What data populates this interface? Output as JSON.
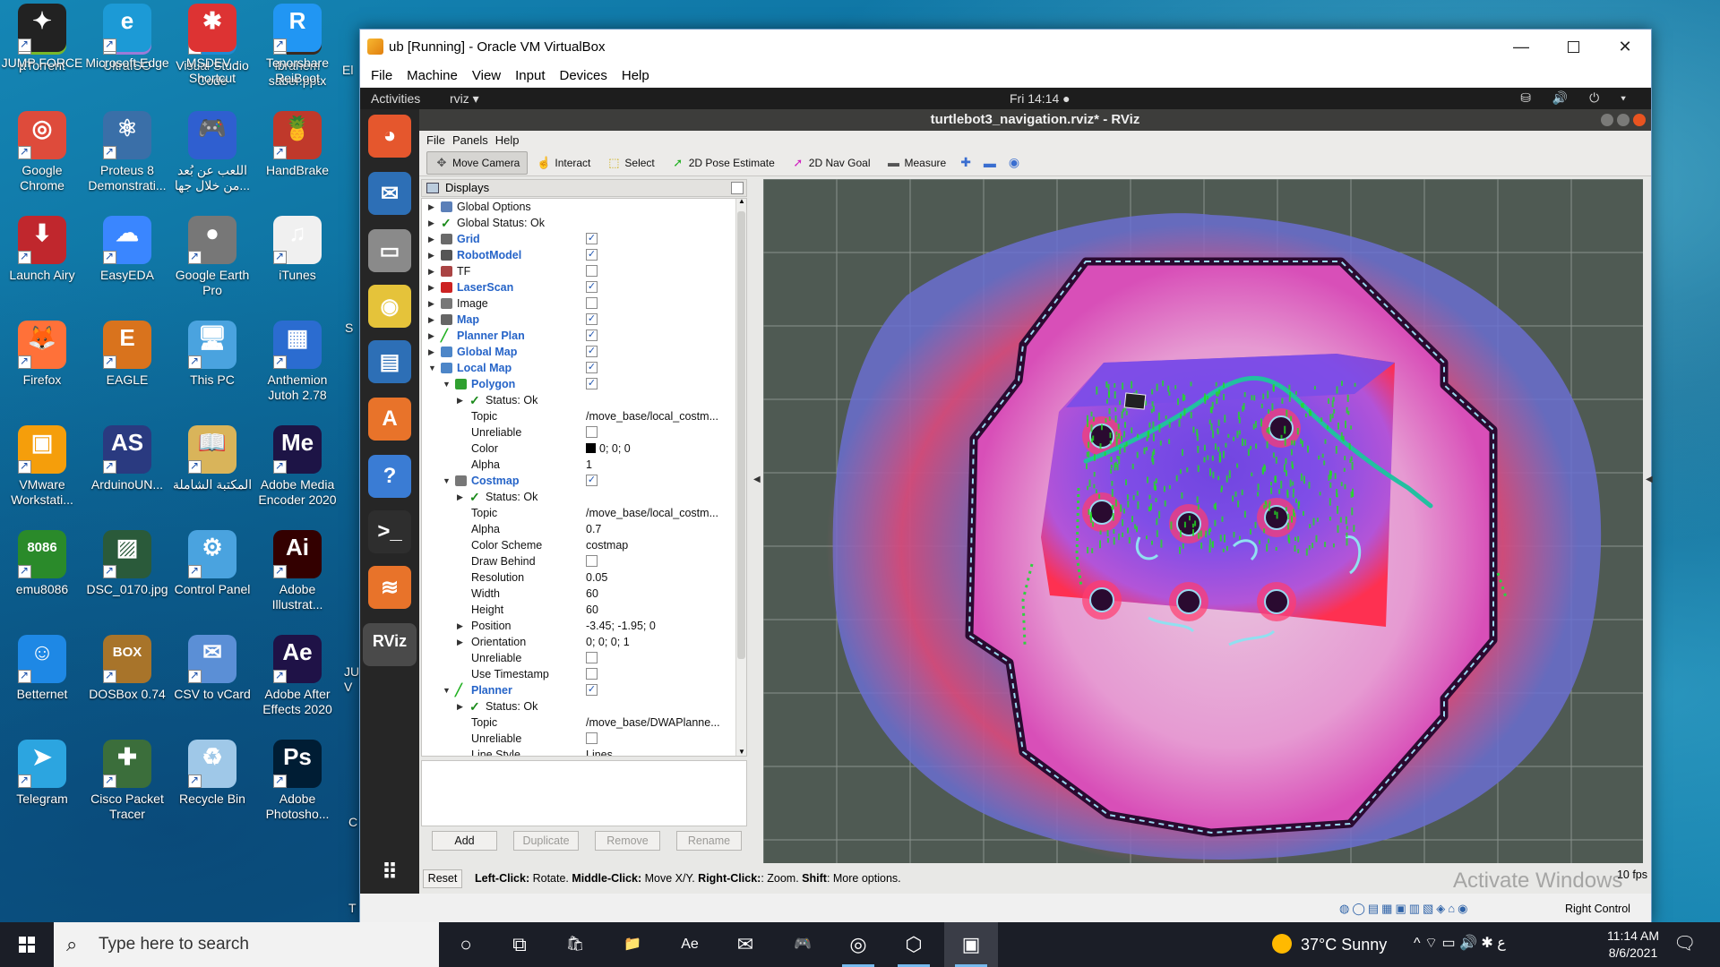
{
  "desktop": {
    "icons": [
      {
        "label": "µTorrent",
        "icon": "utorrent-icon",
        "color": "#78b82a",
        "glyph": "µ"
      },
      {
        "label": "UltraISO",
        "icon": "ultraiso-icon",
        "color": "#9c7bd8",
        "glyph": "◉"
      },
      {
        "label": "Visual Studio Code",
        "icon": "vscode-icon",
        "color": "#1f8ad2",
        "glyph": "❮❯"
      },
      {
        "label": "ibrahem saber.pptx",
        "icon": "pptx-icon",
        "color": "#3a2a20",
        "glyph": "▣"
      },
      {
        "label": "Google Chrome",
        "icon": "chrome-icon",
        "color": "#de4b3b",
        "glyph": "◎"
      },
      {
        "label": "Proteus 8 Demonstrati...",
        "icon": "proteus-icon",
        "color": "#3a6fa8",
        "glyph": "⚛"
      },
      {
        "label": "اللعب عن بُعد من خلال جها...",
        "icon": "remote-play-icon",
        "color": "#2f5fd0",
        "glyph": "🎮"
      },
      {
        "label": "HandBrake",
        "icon": "handbrake-icon",
        "color": "#c0392b",
        "glyph": "🍍"
      },
      {
        "label": "Launch Airy",
        "icon": "airy-icon",
        "color": "#c0272d",
        "glyph": "⬇"
      },
      {
        "label": "EasyEDA",
        "icon": "easyeda-icon",
        "color": "#3a86ff",
        "glyph": "☁"
      },
      {
        "label": "Google Earth Pro",
        "icon": "google-earth-icon",
        "color": "#777",
        "glyph": "●"
      },
      {
        "label": "iTunes",
        "icon": "itunes-icon",
        "color": "#f0f0f0",
        "glyph": "♫"
      },
      {
        "label": "Firefox",
        "icon": "firefox-icon",
        "color": "#ff7139",
        "glyph": "🦊"
      },
      {
        "label": "EAGLE",
        "icon": "eagle-icon",
        "color": "#d9731d",
        "glyph": "E"
      },
      {
        "label": "This PC",
        "icon": "this-pc-icon",
        "color": "#4aa3df",
        "glyph": "🖥"
      },
      {
        "label": "Anthemion Jutoh 2.78",
        "icon": "jutoh-icon",
        "color": "#2b6cd0",
        "glyph": "▦"
      },
      {
        "label": "VMware Workstati...",
        "icon": "vmware-icon",
        "color": "#f59e0b",
        "glyph": "▣"
      },
      {
        "label": "ArduinoUN...",
        "icon": "arduino-icon",
        "color": "#2a3a80",
        "glyph": "AS"
      },
      {
        "label": "المكتبة الشاملة",
        "icon": "library-icon",
        "color": "#d9b45a",
        "glyph": "📖"
      },
      {
        "label": "Adobe Media Encoder 2020",
        "icon": "media-encoder-icon",
        "color": "#1d1446",
        "glyph": "Me"
      },
      {
        "label": "emu8086",
        "icon": "emu8086-icon",
        "color": "#2a8a2a",
        "glyph": "8086"
      },
      {
        "label": "DSC_0170.jpg",
        "icon": "photo-icon",
        "color": "#2a5a3a",
        "glyph": "▨"
      },
      {
        "label": "Control Panel",
        "icon": "control-panel-icon",
        "color": "#4aa3df",
        "glyph": "⚙"
      },
      {
        "label": "Adobe Illustrat...",
        "icon": "illustrator-icon",
        "color": "#330000",
        "glyph": "Ai"
      },
      {
        "label": "Betternet",
        "icon": "betternet-icon",
        "color": "#1e88e5",
        "glyph": "☺"
      },
      {
        "label": "DOSBox 0.74",
        "icon": "dosbox-icon",
        "color": "#a8742a",
        "glyph": "BOX"
      },
      {
        "label": "CSV to vCard",
        "icon": "vcard-icon",
        "color": "#5b8fd6",
        "glyph": "✉"
      },
      {
        "label": "Adobe After Effects 2020",
        "icon": "after-effects-icon",
        "color": "#1f1247",
        "glyph": "Ae"
      },
      {
        "label": "Telegram",
        "icon": "telegram-icon",
        "color": "#2ca5e0",
        "glyph": "➤"
      },
      {
        "label": "Cisco Packet Tracer",
        "icon": "packet-tracer-icon",
        "color": "#3b6e3b",
        "glyph": "✚"
      },
      {
        "label": "Recycle Bin",
        "icon": "recycle-bin-icon",
        "color": "#9fc8e8",
        "glyph": "♻"
      },
      {
        "label": "Adobe Photosho...",
        "icon": "photoshop-icon",
        "color": "#001d34",
        "glyph": "Ps"
      },
      {
        "label": "JUMP FORCE",
        "icon": "jump-force-icon",
        "color": "#222",
        "glyph": "✦"
      },
      {
        "label": "Microsoft Edge",
        "icon": "edge-icon",
        "color": "#1c9ad6",
        "glyph": "e"
      },
      {
        "label": "MSDEV - Shortcut",
        "icon": "msdev-icon",
        "color": "#d33",
        "glyph": "✱"
      },
      {
        "label": "Tenorshare ReiBoot",
        "icon": "reiboot-icon",
        "color": "#2196f3",
        "glyph": "R"
      }
    ],
    "partial_labels": [
      "El",
      "S",
      "JU V",
      "C",
      "T"
    ]
  },
  "vbox": {
    "title": "ub [Running] - Oracle VM VirtualBox",
    "menu": [
      "File",
      "Machine",
      "View",
      "Input",
      "Devices",
      "Help"
    ],
    "status_right_control": "Right Control",
    "status_icons": "◍◯▤▦▣▥▧◈⌂◉"
  },
  "gnome": {
    "activities": "Activities",
    "app_name": "rviz ▾",
    "clock": "Fri 14:14 ●",
    "tray": "⛁ 🔊 ⏻ ▾"
  },
  "dock": [
    {
      "icon": "firefox-icon",
      "color": "#e5572d",
      "glyph": "◕"
    },
    {
      "icon": "thunderbird-icon",
      "color": "#2d6fb6",
      "glyph": "✉"
    },
    {
      "icon": "files-icon",
      "color": "#8a8a8a",
      "glyph": "▭"
    },
    {
      "icon": "rhythmbox-icon",
      "color": "#e5c33a",
      "glyph": "◉"
    },
    {
      "icon": "writer-icon",
      "color": "#2d6fb6",
      "glyph": "▤"
    },
    {
      "icon": "software-icon",
      "color": "#e8732a",
      "glyph": "A"
    },
    {
      "icon": "help-icon",
      "color": "#3a7cd4",
      "glyph": "?"
    },
    {
      "icon": "terminal-icon",
      "color": "#2e2e2e",
      "glyph": ">_"
    },
    {
      "icon": "layers-icon",
      "color": "#e8732a",
      "glyph": "≋"
    },
    {
      "icon": "rviz-icon",
      "color": "#555",
      "glyph": "RViz"
    },
    {
      "icon": "show-apps-icon",
      "color": "transparent",
      "glyph": "⠿"
    }
  ],
  "rviz": {
    "title": "turtlebot3_navigation.rviz* - RViz",
    "menu": [
      "File",
      "Panels",
      "Help"
    ],
    "tools": [
      {
        "label": "Move Camera",
        "icon": "move-camera-icon",
        "glyph": "✥",
        "active": true
      },
      {
        "label": "Interact",
        "icon": "interact-icon",
        "glyph": "☝",
        "active": false
      },
      {
        "label": "Select",
        "icon": "select-icon",
        "glyph": "⬚",
        "active": false
      },
      {
        "label": "2D Pose Estimate",
        "icon": "pose-estimate-icon",
        "glyph": "➚",
        "active": false
      },
      {
        "label": "2D Nav Goal",
        "icon": "nav-goal-icon",
        "glyph": "➚",
        "active": false
      },
      {
        "label": "Measure",
        "icon": "measure-icon",
        "glyph": "▬",
        "active": false
      }
    ],
    "tool_extras": [
      "✚",
      "▬",
      "◉"
    ],
    "displays_header": "Displays",
    "tree": [
      {
        "depth": 0,
        "exp": "▶",
        "icon": "gear",
        "name": "Global Options",
        "blue": false,
        "cb": null,
        "val": ""
      },
      {
        "depth": 0,
        "exp": "▶",
        "icon": "check",
        "name": "Global Status: Ok",
        "blue": false,
        "cb": null,
        "val": ""
      },
      {
        "depth": 0,
        "exp": "▶",
        "icon": "grid",
        "name": "Grid",
        "blue": true,
        "cb": "✓",
        "val": ""
      },
      {
        "depth": 0,
        "exp": "▶",
        "icon": "robot",
        "name": "RobotModel",
        "blue": true,
        "cb": "✓",
        "val": ""
      },
      {
        "depth": 0,
        "exp": "▶",
        "icon": "tf",
        "name": "TF",
        "blue": false,
        "cb": "",
        "val": ""
      },
      {
        "depth": 0,
        "exp": "▶",
        "icon": "laser",
        "name": "LaserScan",
        "blue": true,
        "cb": "✓",
        "val": ""
      },
      {
        "depth": 0,
        "exp": "▶",
        "icon": "image",
        "name": "Image",
        "blue": false,
        "cb": "",
        "val": ""
      },
      {
        "depth": 0,
        "exp": "▶",
        "icon": "map",
        "name": "Map",
        "blue": true,
        "cb": "✓",
        "val": ""
      },
      {
        "depth": 0,
        "exp": "▶",
        "icon": "path",
        "name": "Planner Plan",
        "blue": true,
        "cb": "✓",
        "val": ""
      },
      {
        "depth": 0,
        "exp": "▶",
        "icon": "folder",
        "name": "Global Map",
        "blue": true,
        "cb": "✓",
        "val": ""
      },
      {
        "depth": 0,
        "exp": "▼",
        "icon": "folder",
        "name": "Local Map",
        "blue": true,
        "cb": "✓",
        "val": ""
      },
      {
        "depth": 1,
        "exp": "▼",
        "icon": "polygon",
        "name": "Polygon",
        "blue": true,
        "cb": "✓",
        "val": ""
      },
      {
        "depth": 2,
        "exp": "▶",
        "icon": "check",
        "name": "Status: Ok",
        "blue": false,
        "cb": null,
        "val": ""
      },
      {
        "depth": 2,
        "exp": "",
        "icon": "",
        "name": "Topic",
        "blue": false,
        "cb": null,
        "val": "/move_base/local_costm..."
      },
      {
        "depth": 2,
        "exp": "",
        "icon": "",
        "name": "Unreliable",
        "blue": false,
        "cb": "",
        "val": ""
      },
      {
        "depth": 2,
        "exp": "",
        "icon": "",
        "name": "Color",
        "blue": false,
        "cb": null,
        "val": "0; 0; 0",
        "swatch": "#000000"
      },
      {
        "depth": 2,
        "exp": "",
        "icon": "",
        "name": "Alpha",
        "blue": false,
        "cb": null,
        "val": "1"
      },
      {
        "depth": 1,
        "exp": "▼",
        "icon": "costmap",
        "name": "Costmap",
        "blue": true,
        "cb": "✓",
        "val": ""
      },
      {
        "depth": 2,
        "exp": "▶",
        "icon": "check",
        "name": "Status: Ok",
        "blue": false,
        "cb": null,
        "val": ""
      },
      {
        "depth": 2,
        "exp": "",
        "icon": "",
        "name": "Topic",
        "blue": false,
        "cb": null,
        "val": "/move_base/local_costm..."
      },
      {
        "depth": 2,
        "exp": "",
        "icon": "",
        "name": "Alpha",
        "blue": false,
        "cb": null,
        "val": "0.7"
      },
      {
        "depth": 2,
        "exp": "",
        "icon": "",
        "name": "Color Scheme",
        "blue": false,
        "cb": null,
        "val": "costmap"
      },
      {
        "depth": 2,
        "exp": "",
        "icon": "",
        "name": "Draw Behind",
        "blue": false,
        "cb": "",
        "val": ""
      },
      {
        "depth": 2,
        "exp": "",
        "icon": "",
        "name": "Resolution",
        "blue": false,
        "cb": null,
        "val": "0.05"
      },
      {
        "depth": 2,
        "exp": "",
        "icon": "",
        "name": "Width",
        "blue": false,
        "cb": null,
        "val": "60"
      },
      {
        "depth": 2,
        "exp": "",
        "icon": "",
        "name": "Height",
        "blue": false,
        "cb": null,
        "val": "60"
      },
      {
        "depth": 2,
        "exp": "▶",
        "icon": "",
        "name": "Position",
        "blue": false,
        "cb": null,
        "val": "-3.45; -1.95; 0"
      },
      {
        "depth": 2,
        "exp": "▶",
        "icon": "",
        "name": "Orientation",
        "blue": false,
        "cb": null,
        "val": "0; 0; 0; 1"
      },
      {
        "depth": 2,
        "exp": "",
        "icon": "",
        "name": "Unreliable",
        "blue": false,
        "cb": "",
        "val": ""
      },
      {
        "depth": 2,
        "exp": "",
        "icon": "",
        "name": "Use Timestamp",
        "blue": false,
        "cb": "",
        "val": ""
      },
      {
        "depth": 1,
        "exp": "▼",
        "icon": "path",
        "name": "Planner",
        "blue": true,
        "cb": "✓",
        "val": ""
      },
      {
        "depth": 2,
        "exp": "▶",
        "icon": "check",
        "name": "Status: Ok",
        "blue": false,
        "cb": null,
        "val": ""
      },
      {
        "depth": 2,
        "exp": "",
        "icon": "",
        "name": "Topic",
        "blue": false,
        "cb": null,
        "val": "/move_base/DWAPlanne..."
      },
      {
        "depth": 2,
        "exp": "",
        "icon": "",
        "name": "Unreliable",
        "blue": false,
        "cb": "",
        "val": ""
      },
      {
        "depth": 2,
        "exp": "",
        "icon": "",
        "name": "Line Style",
        "blue": false,
        "cb": null,
        "val": "Lines"
      }
    ],
    "buttons": {
      "add": "Add",
      "duplicate": "Duplicate",
      "remove": "Remove",
      "rename": "Rename"
    },
    "reset": "Reset",
    "help": {
      "left_k": "Left-Click:",
      "left_v": " Rotate. ",
      "mid_k": "Middle-Click:",
      "mid_v": " Move X/Y. ",
      "right_k": "Right-Click:",
      "right_v": ": Zoom. ",
      "shift_k": "Shift",
      "shift_v": ": More options."
    },
    "fps": "10 fps",
    "colors": {
      "grid": "#8a928c",
      "background": "#4f5a53",
      "costmap_hot": "#ff2a4a",
      "inflation": "#6a6fd0",
      "plan": "#22c0a0",
      "laser": "#22dd22"
    }
  },
  "watermark": "Activate Windows",
  "taskbar": {
    "search_placeholder": "Type here to search",
    "apps": [
      {
        "icon": "cortana-icon",
        "glyph": "○"
      },
      {
        "icon": "task-view-icon",
        "glyph": "⧉"
      },
      {
        "icon": "store-icon",
        "glyph": "🛍"
      },
      {
        "icon": "explorer-icon",
        "glyph": "📁"
      },
      {
        "icon": "after-effects-icon",
        "glyph": "Ae"
      },
      {
        "icon": "mail-icon",
        "glyph": "✉"
      },
      {
        "icon": "gamepad-icon",
        "glyph": "🎮"
      },
      {
        "icon": "chrome-icon",
        "glyph": "◎"
      },
      {
        "icon": "virtualbox-cube-icon",
        "glyph": "⬡"
      },
      {
        "icon": "virtualbox-vm-icon",
        "glyph": "▣"
      }
    ],
    "weather": "37°C  Sunny",
    "tray": "^ ⌔ ▭ 🔊 ✱ ع",
    "time": "11:14 AM",
    "date": "8/6/2021"
  }
}
